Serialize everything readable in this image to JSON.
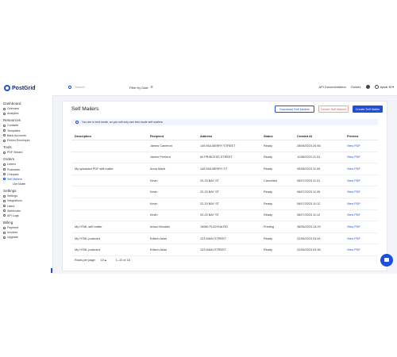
{
  "brand": {
    "name": "PostGrid"
  },
  "sidebar": {
    "sections": [
      {
        "label": "Dashboard",
        "items": [
          {
            "label": "Overview"
          },
          {
            "label": "Analytics"
          }
        ]
      },
      {
        "label": "Resources",
        "items": [
          {
            "label": "Contacts"
          },
          {
            "label": "Templates"
          },
          {
            "label": "Bank Accounts"
          },
          {
            "label": "Return Envelopes"
          }
        ]
      },
      {
        "label": "Tools",
        "items": [
          {
            "label": "PDF Wizard"
          }
        ]
      },
      {
        "label": "Orders",
        "items": [
          {
            "label": "Letters"
          },
          {
            "label": "Postcards"
          },
          {
            "label": "Cheques"
          },
          {
            "label": "Self Mailers",
            "active": true
          }
        ],
        "sub": "Live Mailer"
      },
      {
        "label": "Settings",
        "items": [
          {
            "label": "Settings"
          },
          {
            "label": "Integrations"
          },
          {
            "label": "Users"
          },
          {
            "label": "Webhooks"
          },
          {
            "label": "API Logs"
          }
        ]
      },
      {
        "label": "Billing",
        "items": [
          {
            "label": "Payment"
          },
          {
            "label": "Invoices"
          },
          {
            "label": "Upgrade"
          }
        ]
      }
    ]
  },
  "topbar": {
    "search_placeholder": "Search",
    "filter_label": "Filter by Date",
    "api_docs": "API Documentation",
    "guides": "Guides",
    "user_name": "Ajwar M"
  },
  "page": {
    "title": "Self Mailers",
    "buttons": {
      "download": "Download Self Mailers",
      "cancel": "Cancel Self Mailers",
      "create": "Create Self Mailer"
    },
    "alert": "You are in test mode, so you will only see test mode self mailers"
  },
  "table": {
    "headers": [
      "Description",
      "Recipient",
      "Address",
      "Status",
      "Created At",
      "Preview"
    ],
    "rows": [
      [
        "",
        "James Cameron",
        "145 MULBERRY STREET",
        "Ready",
        "28/08/2023 20:56",
        "View PDF"
      ],
      [
        "",
        "James Perriera",
        "60 PRINCESS STREET",
        "Ready",
        "11/08/2023 21:31",
        "View PDF"
      ],
      [
        "My uploaded PDF self mailer",
        "Anna Marie",
        "145 MULBERRY ST",
        "Ready",
        "09/08/2023 11:05",
        "View PDF"
      ],
      [
        "",
        "Kevin",
        "20-20 BAY ST",
        "Cancelled",
        "06/07/2023 11:31",
        "View PDF"
      ],
      [
        "",
        "Kevin",
        "20-20 BAY ST",
        "Ready",
        "06/07/2023 11:26",
        "View PDF"
      ],
      [
        "",
        "Kevin",
        "22-20 BAY ST",
        "Ready",
        "06/07/2023 11:12",
        "View PDF"
      ],
      [
        "",
        "Kevin",
        "20-20 BAY ST",
        "Ready",
        "06/07/2023 11:12",
        "View PDF"
      ],
      [
        "My HTML self mailer",
        "Arturo Morales",
        "16080 FUCHSIA RD",
        "Printing",
        "28/06/2023 14:29",
        "View PDF"
      ],
      [
        "My HTML postcard",
        "Edison Arias",
        "123 MAIN STREET",
        "Ready",
        "22/06/2023 03:44",
        "View PDF"
      ],
      [
        "My HTML postcard",
        "Edison Arias",
        "123 MAIN STREET",
        "Ready",
        "22/06/2023 03:36",
        "View PDF"
      ]
    ]
  },
  "pager": {
    "rows_per_page_label": "Rows per page:",
    "rows_per_page": "10",
    "range": "1–10 of 16"
  },
  "colors": {
    "accent": "#1f4fd8",
    "danger": "#e05656"
  }
}
